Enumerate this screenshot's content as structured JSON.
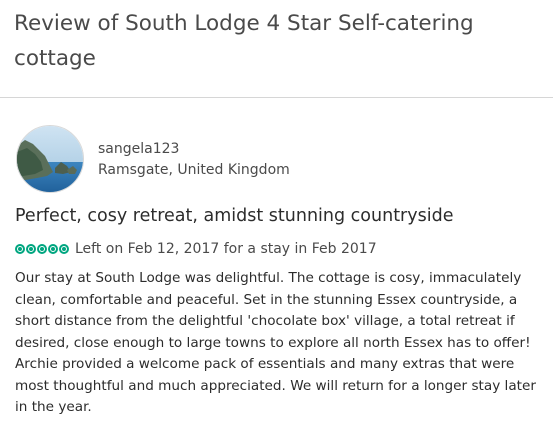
{
  "header": {
    "title": "Review of South Lodge 4 Star Self-catering cottage"
  },
  "reviewer": {
    "username": "sangela123",
    "location": "Ramsgate, United Kingdom",
    "avatar_icon": "landscape-photo"
  },
  "review": {
    "title": "Perfect, cosy retreat, amidst stunning countryside",
    "rating": 5,
    "rating_max": 5,
    "rating_color": "#00a680",
    "date_text": "Left on Feb 12, 2017 for a stay in Feb 2017",
    "body": "Our stay at South Lodge was delightful. The cottage is cosy, immaculately clean, comfortable and peaceful. Set in the stunning Essex countryside, a short distance from the delightful 'chocolate box' village, a total retreat if desired, close enough to large towns to explore all north Essex has to offer! Archie provided a welcome pack of essentials and many extras that were most thoughtful and much appreciated. We will return for a longer stay later in the year."
  }
}
